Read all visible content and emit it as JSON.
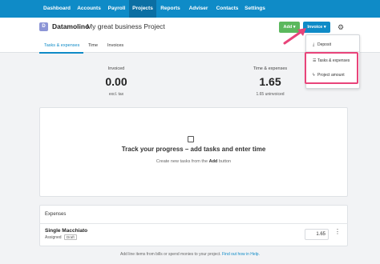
{
  "nav": {
    "items": [
      {
        "label": "Dashboard",
        "active": false
      },
      {
        "label": "Accounts",
        "active": false
      },
      {
        "label": "Payroll",
        "active": false
      },
      {
        "label": "Projects",
        "active": true
      },
      {
        "label": "Reports",
        "active": false
      },
      {
        "label": "Adviser",
        "active": false
      },
      {
        "label": "Contacts",
        "active": false
      },
      {
        "label": "Settings",
        "active": false
      }
    ]
  },
  "header": {
    "project_initial": "D",
    "client": "Datamolino",
    "project": "My great business Project",
    "add_label": "Add ▾",
    "invoice_label": "Invoice ▾"
  },
  "tabs": [
    {
      "label": "Tasks & expenses",
      "active": true
    },
    {
      "label": "Time",
      "active": false
    },
    {
      "label": "Invoices",
      "active": false
    }
  ],
  "stats": {
    "invoiced": {
      "label": "Invoiced",
      "value": "0.00",
      "sub": "excl. tax"
    },
    "time_expenses": {
      "label": "Time & expenses",
      "value": "1.65",
      "sub": "1.65 uninvoiced"
    }
  },
  "progress": {
    "title": "Track your progress – add tasks and enter time",
    "sub_before": "Create new tasks from the ",
    "sub_bold": "Add",
    "sub_after": " button"
  },
  "expenses": {
    "header": "Expenses",
    "row": {
      "name": "Single Macchiato",
      "assigned": "Assigned",
      "badge": "Draft",
      "amount": "1.65"
    }
  },
  "footer": {
    "text": "Add line items from bills or spend monies to your project. ",
    "link": "Find out how in Help."
  },
  "dropdown": {
    "items": [
      {
        "label": "Deposit",
        "icon": "download-icon"
      },
      {
        "label": "Tasks & expenses",
        "icon": "list-icon"
      },
      {
        "label": "Project amount",
        "icon": "lightning-icon"
      }
    ]
  },
  "colors": {
    "nav": "#0f8bc7",
    "add_button": "#5bb85d",
    "highlight": "#e8447a"
  }
}
